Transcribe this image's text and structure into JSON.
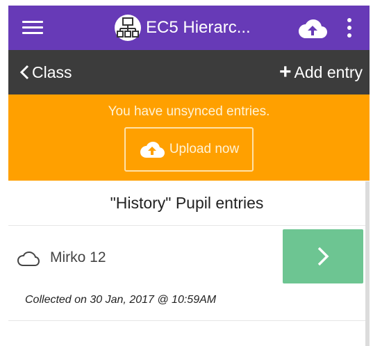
{
  "appbar": {
    "title": "EC5 Hierarc...",
    "background": "#673ab7",
    "logo_icon": "hierarchy-network-icon",
    "menu_icon": "hamburger-menu-icon",
    "upload_icon": "cloud-upload-icon",
    "more_icon": "more-vertical-icon"
  },
  "toolbar": {
    "back_label": "Class",
    "add_entry_label": "Add entry",
    "background": "#3c3c3c"
  },
  "banner": {
    "message": "You have unsynced entries.",
    "upload_label": "Upload now",
    "background": "#ffa000"
  },
  "list": {
    "header": "\"History\" Pupil entries",
    "entries": [
      {
        "title": "Mirko 12",
        "collected": "Collected on 30 Jan, 2017 @ 10:59AM",
        "status_icon": "cloud-outline-icon",
        "action_icon": "chevron-right-icon",
        "action_color": "#6dc592"
      }
    ]
  }
}
